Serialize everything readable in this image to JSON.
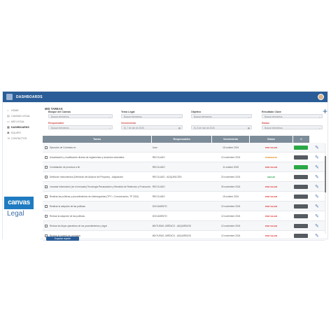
{
  "header": {
    "title": "DASHBOARDS"
  },
  "sidebar": {
    "items": [
      {
        "label": "HOME",
        "icon": "home-icon",
        "active": false
      },
      {
        "label": "CANVAS LEGAL",
        "icon": "doc-icon",
        "active": false
      },
      {
        "label": "MIS LEGAL",
        "icon": "folder-icon",
        "active": false
      },
      {
        "label": "DASHBOARDS",
        "icon": "chart-icon",
        "active": true
      },
      {
        "label": "EQUIPO",
        "icon": "team-icon",
        "active": false
      },
      {
        "label": "CONTACTOS",
        "icon": "contacts-icon",
        "active": false
      }
    ],
    "logo_top": "canvas",
    "logo_bottom": "Legal"
  },
  "main": {
    "title": "MIS TAREAS",
    "filters": {
      "bloque": {
        "label": "Bloque del Canvas",
        "value": "Buscar elementos"
      },
      "tema": {
        "label": "Tema Legal",
        "value": "Buscar elementos"
      },
      "objetivo": {
        "label": "Objetivo",
        "value": "Buscar elementos"
      },
      "resultado": {
        "label": "Resultado Clave",
        "value": "Buscar elementos"
      },
      "responsable": {
        "label": "Responsable",
        "value": "Buscar elementos"
      },
      "vencimiento": {
        "label": "Vencimiento",
        "value_from": "Ej. 7 de abr de 2026",
        "value_to": "Ej. 8 de mar de 2026"
      },
      "status": {
        "label": "Status",
        "value": "Buscar elementos"
      }
    },
    "columns": [
      "Tareas",
      "Responsables",
      "Vencimiento",
      "Status",
      "C"
    ],
    "rows": [
      {
        "task": "Ejecución de Contratos en",
        "resp": "Juan",
        "due": "15 octubre 2024",
        "status": "POR VALER",
        "stype": "red",
        "c": "green"
      },
      {
        "task": "Actualización y modificación diversa de reglamentos y acuerdos sectoriales",
        "resp": "RECOLADO",
        "due": "12 noviembre 2024",
        "status": "PENDIENTE",
        "stype": "orange",
        "c": "dark"
      },
      {
        "task": "Contratación de procesos a fin",
        "resp": "RECOLADO",
        "due": "11 octubre 2025",
        "status": "POR VALER",
        "stype": "red",
        "c": "green"
      },
      {
        "task": "Definición Instrumentos (Definición del Alcance del Proyecto) - Adquisición",
        "resp": "RECOLADO - ADQUISICIÓN",
        "due": "20 noviembre 2024",
        "status": "HECHO",
        "stype": "green",
        "c": "dark"
      },
      {
        "task": "Levantar información (en el mercado) Tecnología Recaudación y Remisión de Retención y Producción",
        "resp": "RECOLADO",
        "due": "30 noviembre 2024",
        "status": "POR VALER",
        "stype": "red",
        "c": "dark"
      },
      {
        "task": "Realizar las políticas y procedimientos de ciberseguridad (TPY = Comunicación, TP 2024)",
        "resp": "RECOLADO",
        "due": "15 octubre 2024",
        "status": "POR VALER",
        "stype": "red",
        "c": "dark"
      },
      {
        "task": "Realizar la adopción de las políticas",
        "resp": "DOCUMENTO",
        "due": "12 noviembre 2024",
        "status": "POR VALER",
        "stype": "red",
        "c": "dark"
      },
      {
        "task": "Revisar la adopción de las políticas",
        "resp": "DOCUMENTO",
        "due": "12 noviembre 2024",
        "status": "POR VALER",
        "stype": "red",
        "c": "dark"
      },
      {
        "task": "Revisar los flujos operativos de los procedimientos y legal",
        "resp": "MIXTURAS JURÍDICO - ADQUIRIDOS",
        "due": "12 noviembre 2024",
        "status": "POR VALER",
        "stype": "red",
        "c": "dark"
      },
      {
        "task": "Revisar el modelo de contratos",
        "resp": "MIXTURAS JURÍDICO - ADQUIRIDOS",
        "due": "12 noviembre 2024",
        "status": "POR VALER",
        "stype": "red",
        "c": "dark"
      }
    ],
    "export_label": "Exportar reporte"
  },
  "colors": {
    "accent": "#2a5d97",
    "header_table": "#7d8c99",
    "status_red": "#e02f2f",
    "status_green": "#1e9e47"
  }
}
